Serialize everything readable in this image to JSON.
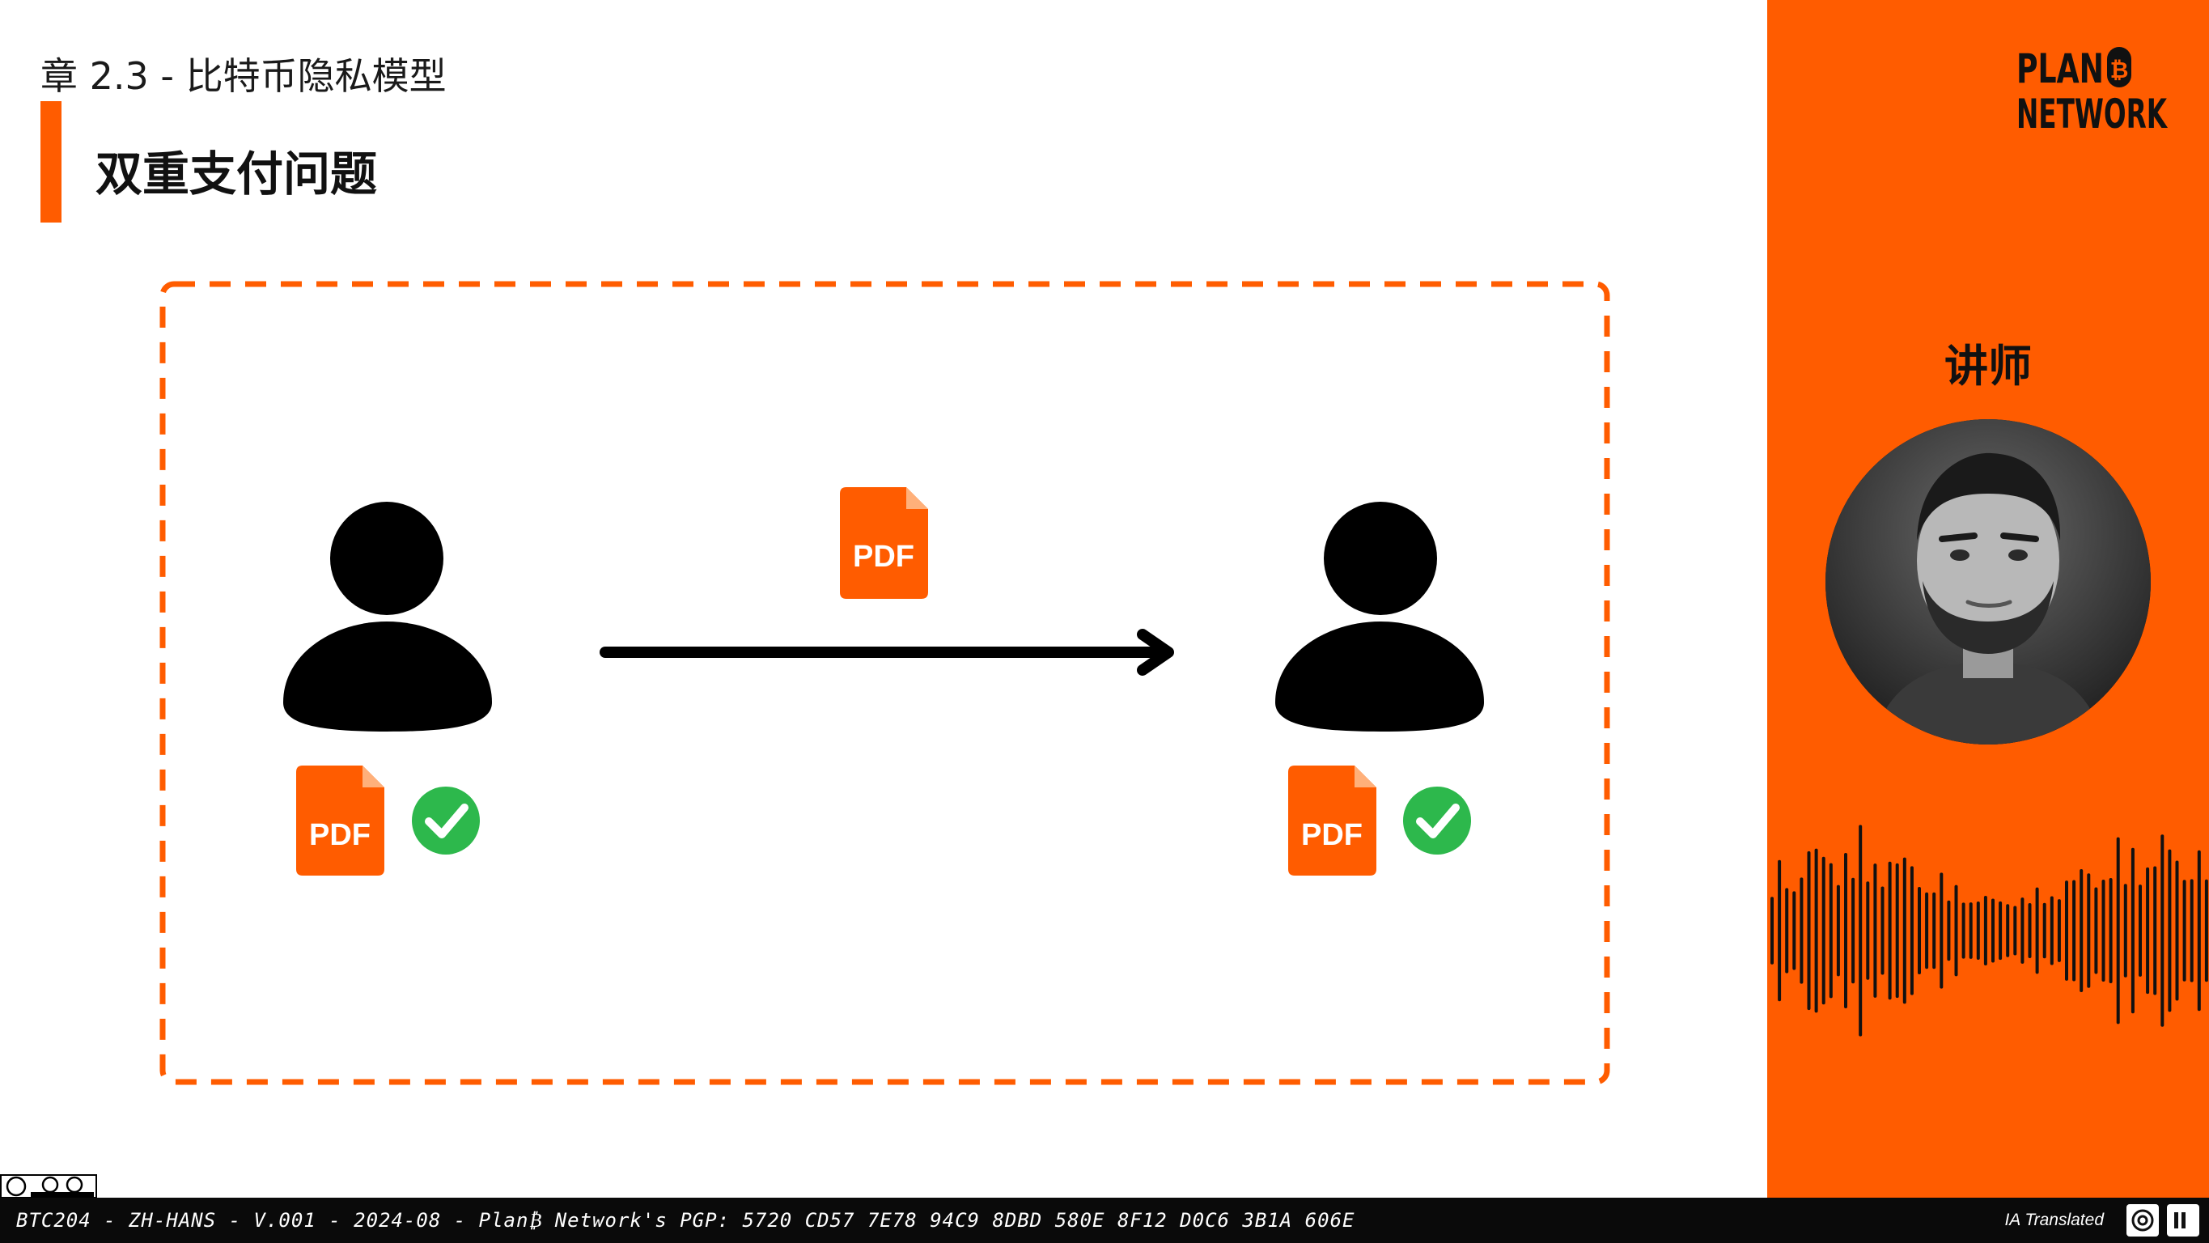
{
  "header": {
    "chapter": "章 2.3 - 比特币隐私模型",
    "title": "双重支付问题"
  },
  "diagram": {
    "document_label": "PDF",
    "sender_icon": "user-icon",
    "receiver_icon": "user-icon",
    "document_icon": "pdf-file-icon",
    "check_icon": "check-circle-icon",
    "arrow_icon": "arrow-right-icon",
    "colors": {
      "accent": "#FF5C00",
      "check": "#2DB84C",
      "ink": "#000000"
    }
  },
  "sidebar": {
    "logo_line1": "PLAN",
    "logo_bitcoin_symbol": "₿",
    "logo_line2": "NETWORK",
    "instructor_label": "讲师",
    "avatar_icon": "instructor-photo",
    "waveform_icon": "audio-waveform-icon"
  },
  "footer": {
    "license_icon": "cc-by-sa-icon",
    "metadata": "BTC204 - ZH-HANS - V.001 - 2024-08 - Plan₿ Network's PGP: 5720 CD57 7E78 94C9 8DBD 580E 8F12 D0C6 3B1A 606E",
    "ia_label": "IA Translated",
    "ai_icon": "openai-icon",
    "tts_icon": "elevenlabs-icon"
  }
}
